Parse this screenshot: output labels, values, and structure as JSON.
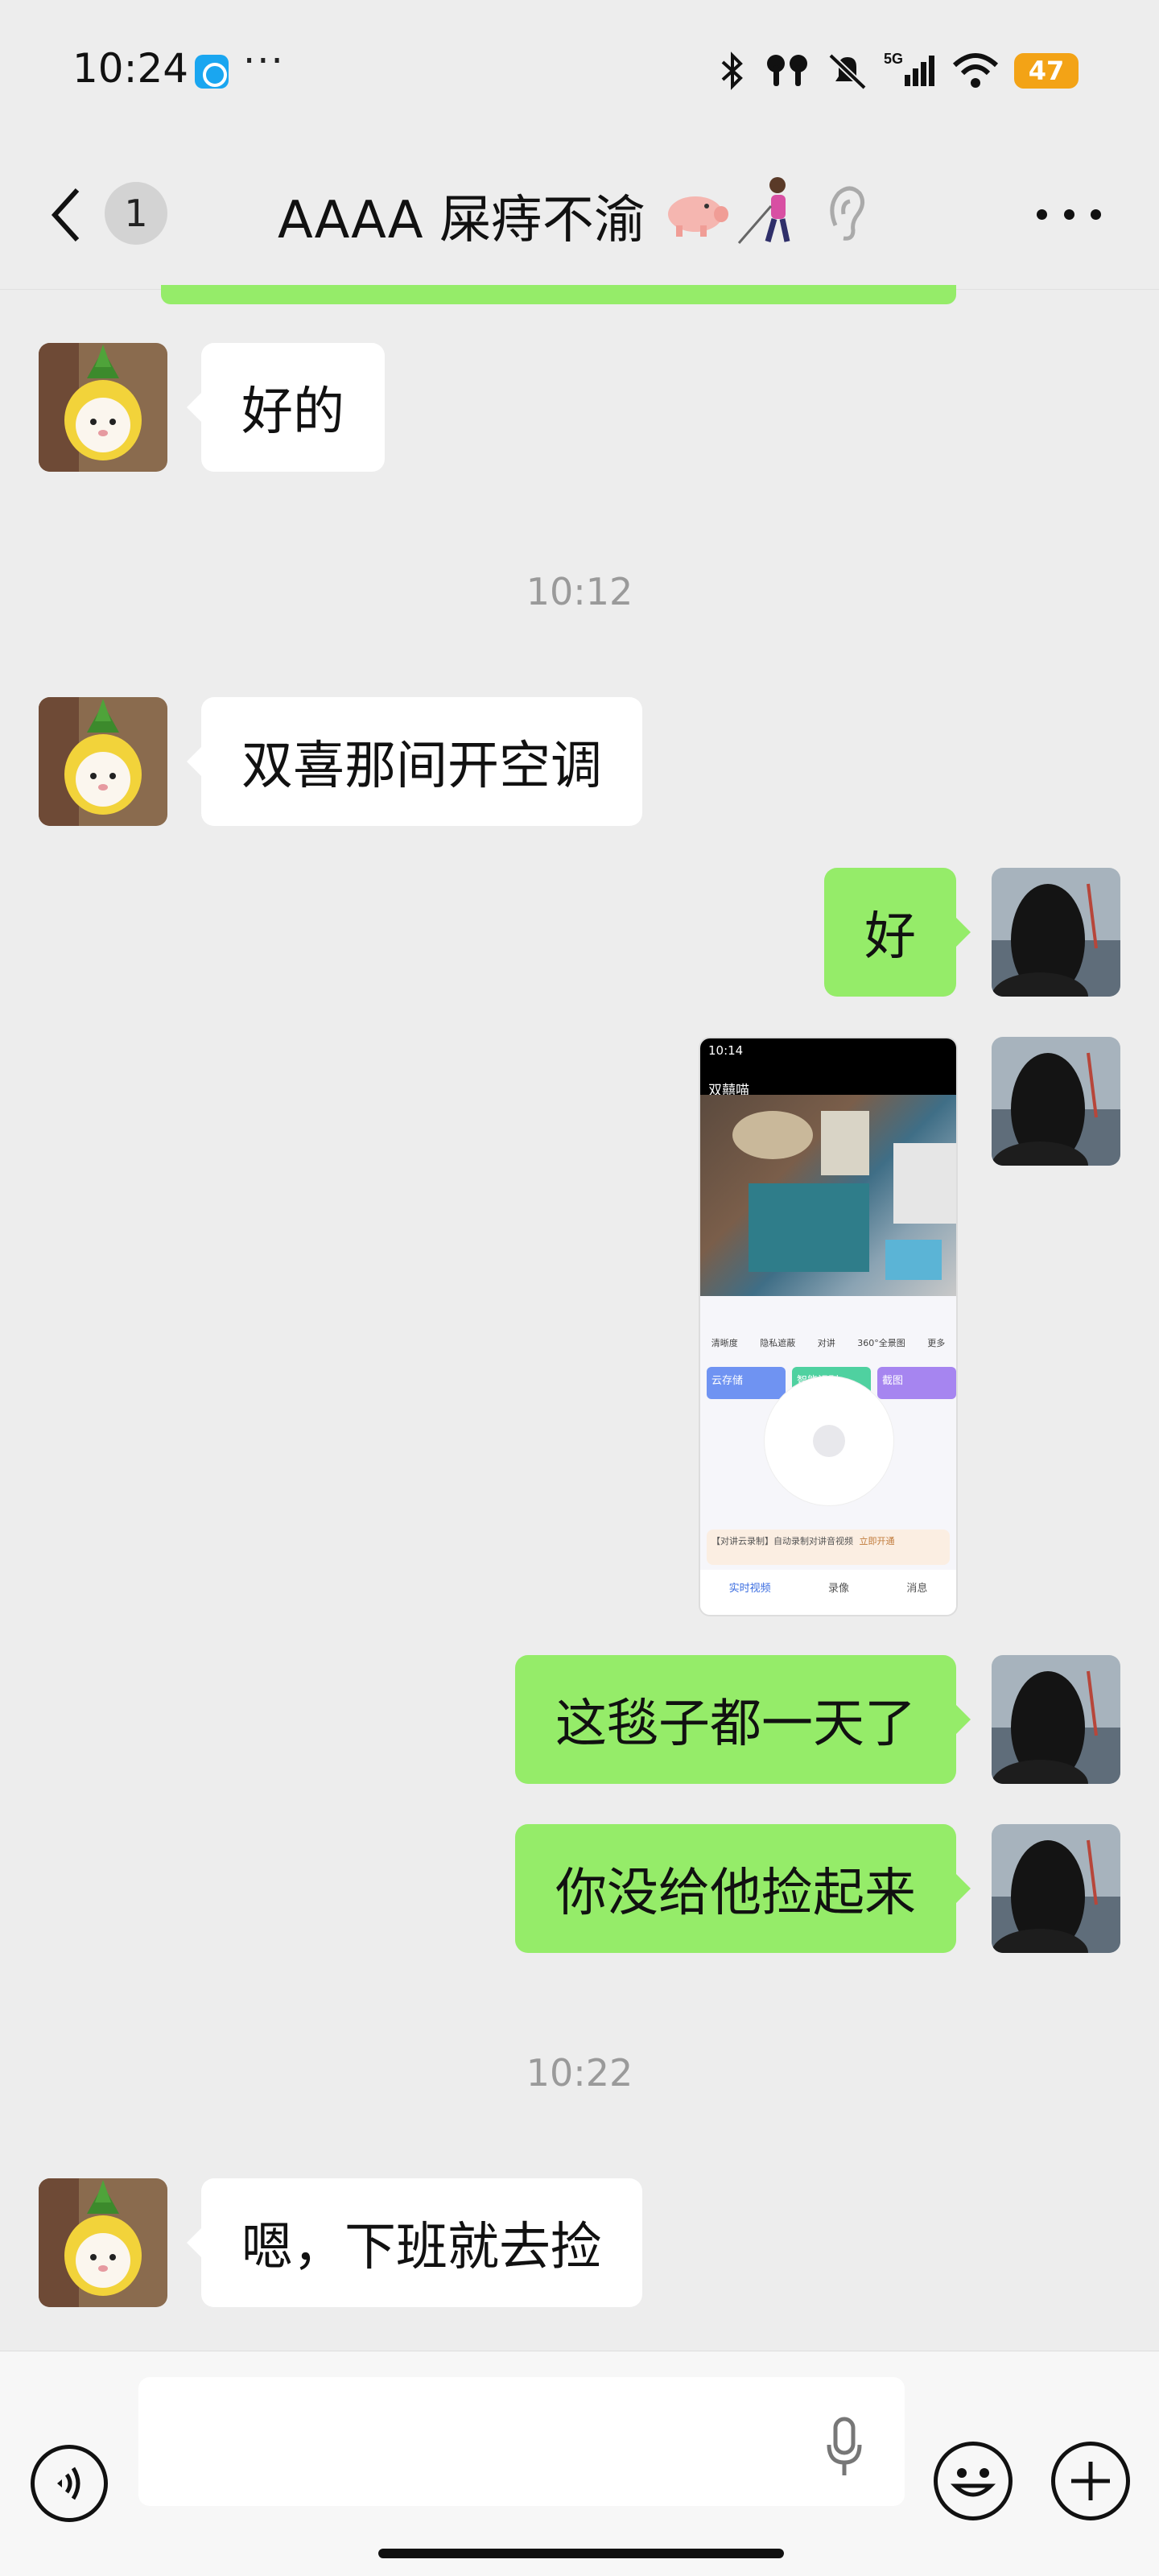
{
  "status_bar": {
    "time": "10:24",
    "more": "···",
    "battery": "47",
    "network": "5G"
  },
  "nav": {
    "unread_count": "1",
    "title": "AAAA 屎痔不渝",
    "title_emojis": [
      "pig-emoji",
      "person-with-cane-emoji",
      "ear-icon"
    ]
  },
  "messages": [
    {
      "sender": "other",
      "type": "text",
      "text": "好的"
    },
    {
      "type": "time",
      "text": "10:12"
    },
    {
      "sender": "other",
      "type": "text",
      "text": "双喜那间开空调"
    },
    {
      "sender": "self",
      "type": "text",
      "text": "好"
    },
    {
      "sender": "self",
      "type": "image",
      "image": {
        "status_time": "10:14",
        "nav_title": "双囍喵",
        "tools": [
          "清晰度",
          "隐私遮蔽",
          "对讲",
          "360°全景图",
          "更多"
        ],
        "cards": [
          "云存储",
          "智能识别",
          "截图"
        ],
        "notice": "【对讲云录制】自动录制对讲音视频",
        "notice_action": "立即开通",
        "tabs": [
          "实时视频",
          "录像",
          "消息"
        ]
      }
    },
    {
      "sender": "self",
      "type": "text",
      "text": "这毯子都一天了"
    },
    {
      "sender": "self",
      "type": "text",
      "text": "你没给他捡起来"
    },
    {
      "type": "time",
      "text": "10:22"
    },
    {
      "sender": "other",
      "type": "text",
      "text": "嗯，下班就去捡"
    }
  ],
  "input": {
    "placeholder": ""
  },
  "colors": {
    "self_bubble": "#95ec69",
    "other_bubble": "#ffffff",
    "background": "#ededed"
  }
}
